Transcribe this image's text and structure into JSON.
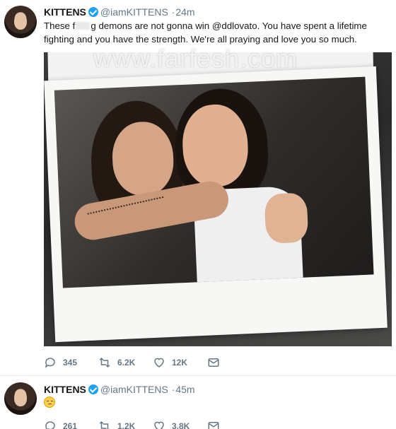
{
  "tweets": [
    {
      "display_name": "KITTENS",
      "handle": "@iamKITTENS",
      "separator": "·",
      "time": "24m",
      "text_prefix": "These f",
      "text_suffix": "g demons are not gonna win @ddlovato. You have spent a lifetime fighting and you have the strength. We're all praying and love you so much.",
      "stats": {
        "replies": "345",
        "retweets": "6.2K",
        "likes": "12K"
      }
    },
    {
      "display_name": "KITTENS",
      "handle": "@iamKITTENS",
      "separator": "·",
      "time": "45m",
      "emoji": "relieved-face",
      "stats": {
        "replies": "261",
        "retweets": "1.2K",
        "likes": "3.8K"
      }
    }
  ],
  "watermark": "www.farfesh.com",
  "colors": {
    "verified": "#1da1f2",
    "meta_text": "#657786",
    "body_text": "#14171a"
  }
}
